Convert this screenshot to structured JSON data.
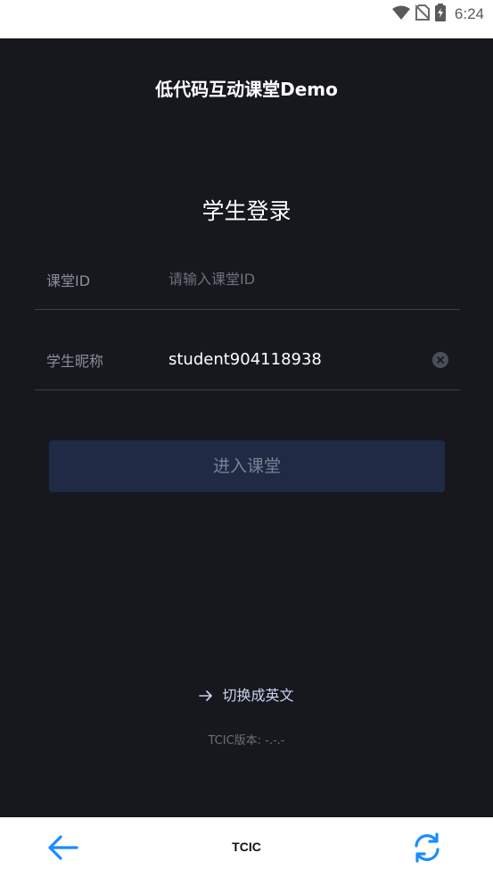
{
  "status_bar": {
    "time": "6:24",
    "icons": [
      "wifi-icon",
      "no-sim-icon",
      "battery-charging-icon"
    ]
  },
  "header": {
    "title": "低代码互动课堂Demo"
  },
  "login": {
    "title": "学生登录",
    "room_field": {
      "label": "课堂ID",
      "placeholder": "请输入课堂ID",
      "value": ""
    },
    "nickname_field": {
      "label": "学生昵称",
      "value": "student904118938"
    },
    "enter_button_label": "进入课堂"
  },
  "footer": {
    "switch_language_label": "切换成英文",
    "version_label": "TCIC版本: -.-.-"
  },
  "bottom_bar": {
    "title": "TCIC",
    "back_icon": "arrow-left-icon",
    "refresh_icon": "refresh-icon"
  },
  "colors": {
    "background": "#16181e",
    "accent": "#1a8cff",
    "button_bg": "#1f2a44"
  }
}
